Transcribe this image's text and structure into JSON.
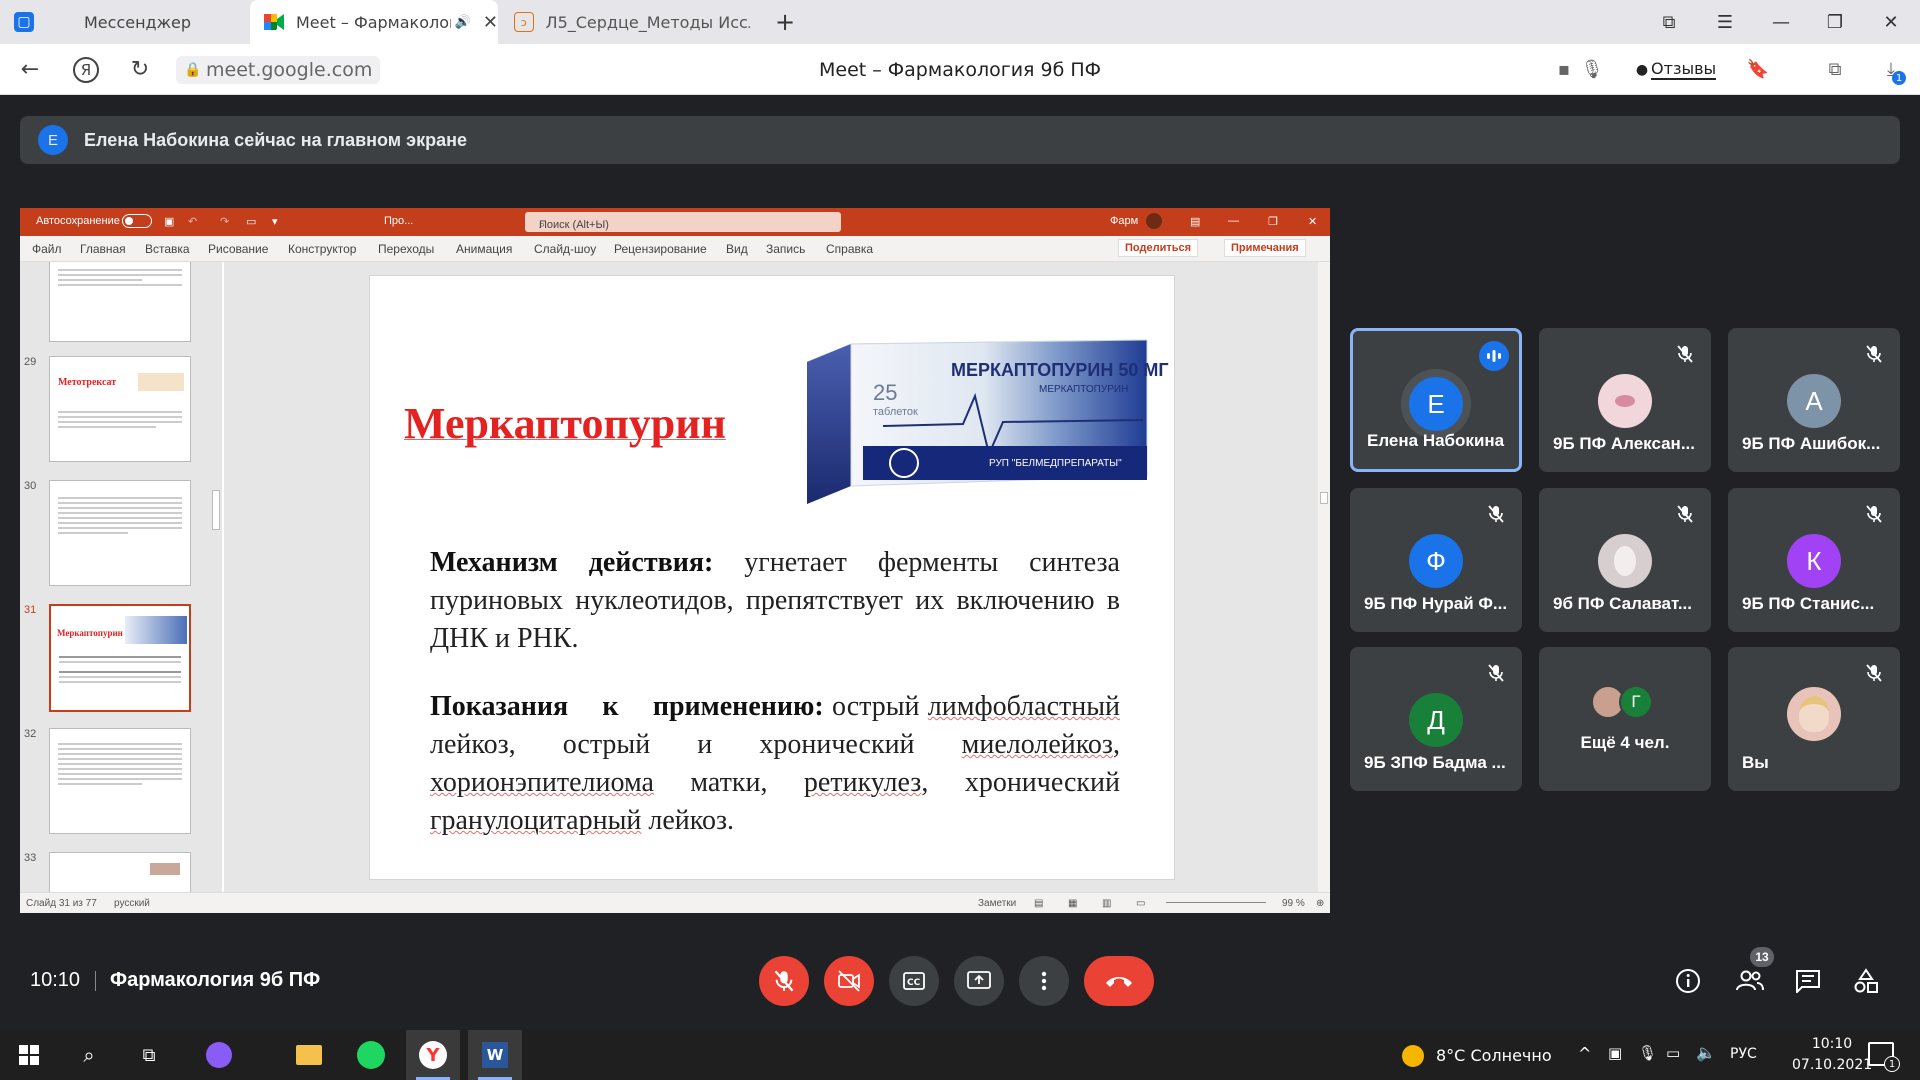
{
  "browser": {
    "tabs": [
      {
        "label": "Мессенджер",
        "icon": "messenger-icon"
      },
      {
        "label": "Meet – Фармакология",
        "icon": "meet-icon"
      },
      {
        "label": "Л5_Сердце_Методы Иссле",
        "icon": "pdf-icon"
      }
    ],
    "url": "meet.google.com",
    "page_title": "Meet – Фармакология 9б ПФ",
    "feedback_label": "Отзывы",
    "downloads_badge": "1"
  },
  "meet": {
    "banner_avatar": "Е",
    "banner_text": "Елена Набокина сейчас на главном экране",
    "time": "10:10",
    "meeting_name": "Фармакология 9б ПФ",
    "participants_count": "13",
    "colors": {
      "background": "#202124",
      "tile": "#3c4043",
      "end_call": "#ea4335",
      "speaking": "#8ab4f8"
    }
  },
  "ppt": {
    "autosave": "Автосохранение",
    "doc_name": "Про...",
    "search_placeholder": "Поиск (Alt+Ы)",
    "user_short": "Фарм",
    "ribbon": [
      "Файл",
      "Главная",
      "Вставка",
      "Рисование",
      "Конструктор",
      "Переходы",
      "Анимация",
      "Слайд-шоу",
      "Рецензирование",
      "Вид",
      "Запись",
      "Справка"
    ],
    "share_label": "Поделиться",
    "notes_label": "Примечания",
    "thumb_numbers": [
      "29",
      "30",
      "31",
      "32",
      "33"
    ],
    "thumb_29_title": "Метотрексат",
    "thumb_31_title": "Меркаптопурин",
    "status_slide": "Слайд 31 из 77",
    "status_lang": "русский",
    "status_notes": "Заметки",
    "zoom": "99 %"
  },
  "slide": {
    "title": "Меркаптопурин",
    "box_brand": "МЕРКАПТОПУРИН 50 МГ",
    "box_sub": "МЕРКАПТОПУРИН",
    "box_count": "25",
    "box_unit": "таблеток",
    "box_maker": "РУП \"БЕЛМЕДПРЕПАРАТЫ\"",
    "mech_label": "Механизм действия:",
    "mech_text": " угнетает ферменты синтеза пуриновых нуклеотидов, препятствует их включению в ДНК и РНК.",
    "ind_label": "Показания к применению:",
    "ind_1": " острый ",
    "ind_2": "лимфобластный",
    "ind_3": " лейкоз, острый и хронический ",
    "ind_4": "миелолейкоз",
    "ind_5": ", ",
    "ind_6": "хорионэпителиома",
    "ind_7": " матки, ",
    "ind_8": "ретикулез",
    "ind_9": ", хронический ",
    "ind_10": "гранулоцитарный",
    "ind_11": " лейкоз."
  },
  "tiles": [
    {
      "name": "Елена Набокина",
      "avatar": "Е",
      "color": "#1a73e8",
      "speaking": true
    },
    {
      "name": "9Б ПФ Алексан...",
      "avatar": "",
      "color": "#f1d6dc",
      "muted": true
    },
    {
      "name": "9Б ПФ Ашибок...",
      "avatar": "А",
      "color": "#7d93a8",
      "muted": true
    },
    {
      "name": "9Б ПФ Нурай Ф...",
      "avatar": "Ф",
      "color": "#1a73e8",
      "muted": true
    },
    {
      "name": "9б ПФ Салават...",
      "avatar": "",
      "color": "#d7cfcf",
      "muted": true
    },
    {
      "name": "9Б ПФ Станис...",
      "avatar": "К",
      "color": "#a142f4",
      "muted": true
    },
    {
      "name": "9Б ЗПФ Бадма ...",
      "avatar": "Д",
      "color": "#188038",
      "muted": true
    },
    {
      "name": "Ещё 4 чел.",
      "avatar": "Г",
      "color": "#188038"
    },
    {
      "name": "Вы",
      "avatar": "",
      "color": "#e8c3b9",
      "muted": true
    }
  ],
  "taskbar": {
    "weather": "8°C  Солнечно",
    "lang": "РУС",
    "time": "10:10",
    "date": "07.10.2021",
    "notif": "1"
  }
}
